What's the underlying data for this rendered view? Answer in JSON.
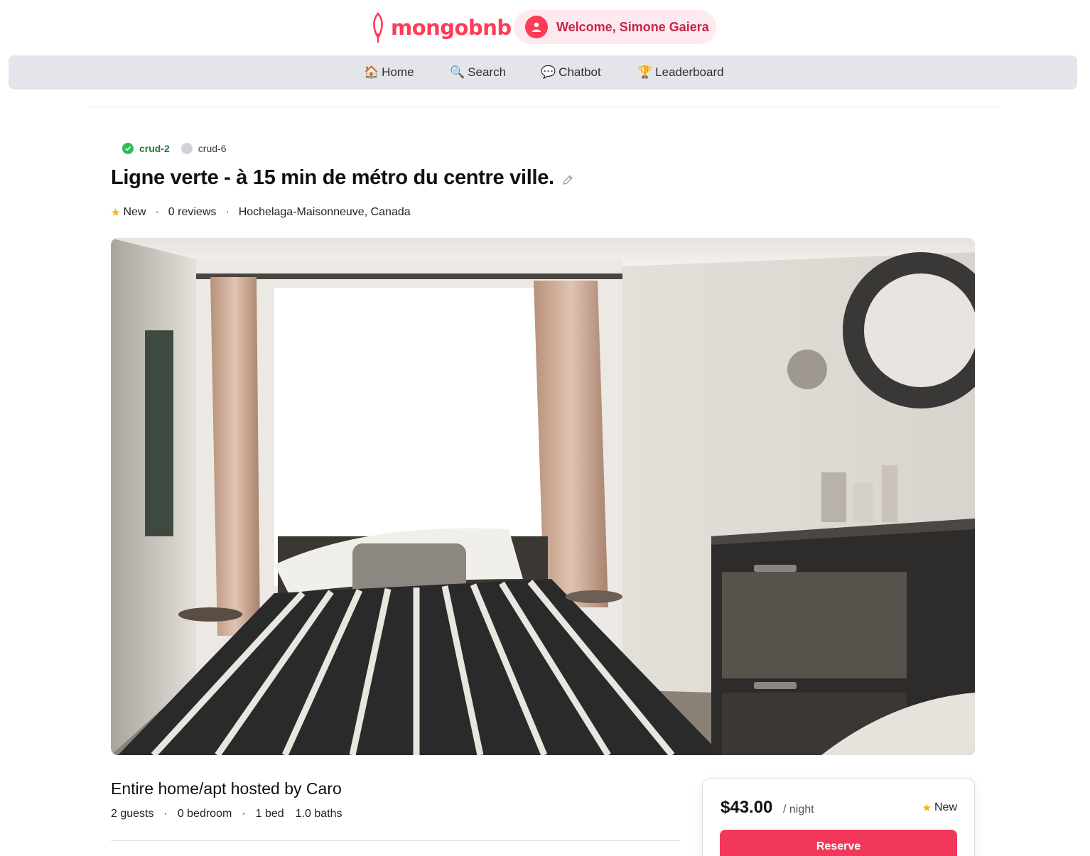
{
  "header": {
    "logo_text": "mongobnb",
    "welcome_text": "Welcome, Simone Gaiera",
    "brand_color": "#ff3b55"
  },
  "nav": {
    "items": [
      {
        "icon": "🏠",
        "icon_name": "house-icon",
        "label": "Home"
      },
      {
        "icon": "🔍",
        "icon_name": "magnifier-icon",
        "label": "Search"
      },
      {
        "icon": "💬",
        "icon_name": "speech-bubble-icon",
        "label": "Chatbot"
      },
      {
        "icon": "🏆",
        "icon_name": "trophy-icon",
        "label": "Leaderboard"
      }
    ]
  },
  "tags": {
    "active": "crud-2",
    "inactive": "crud-6"
  },
  "listing": {
    "title": "Ligne verte - à 15 min de métro du centre ville.",
    "rating": "New",
    "reviews": "0 reviews",
    "location": "Hochelaga-Maisonneuve, Canada",
    "host_title": "Entire home/apt hosted by Caro",
    "guests": "2 guests",
    "bedrooms": "0 bedroom",
    "beds": "1 bed",
    "baths": "1.0 baths"
  },
  "booking": {
    "price": "$43.00",
    "per_night": "/ night",
    "rating": "New",
    "reserve_label": "Reserve",
    "accent_color": "#f2375a"
  }
}
